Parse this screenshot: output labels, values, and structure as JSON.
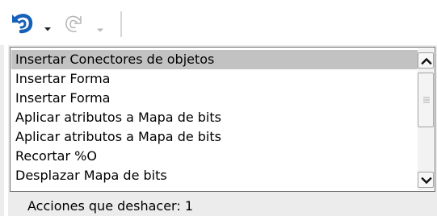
{
  "toolbar": {
    "undo_icon": "undo-icon",
    "undo_dropdown_icon": "chevron-down-icon",
    "redo_icon": "redo-icon",
    "redo_dropdown_icon": "chevron-down-icon"
  },
  "undo_list": {
    "items": [
      {
        "label": "Insertar Conectores de objetos",
        "selected": true
      },
      {
        "label": "Insertar Forma",
        "selected": false
      },
      {
        "label": "Insertar Forma",
        "selected": false
      },
      {
        "label": "Aplicar atributos a Mapa de bits",
        "selected": false
      },
      {
        "label": "Aplicar atributos a Mapa de bits",
        "selected": false
      },
      {
        "label": "Recortar %O",
        "selected": false
      },
      {
        "label": "Desplazar Mapa de bits",
        "selected": false
      }
    ],
    "status": "Acciones que deshacer: 1"
  },
  "colors": {
    "undo_icon": "#1560b8",
    "redo_icon_disabled": "#b5b5b5",
    "selection": "#c2c2c2",
    "panel_background": "#ececec"
  }
}
